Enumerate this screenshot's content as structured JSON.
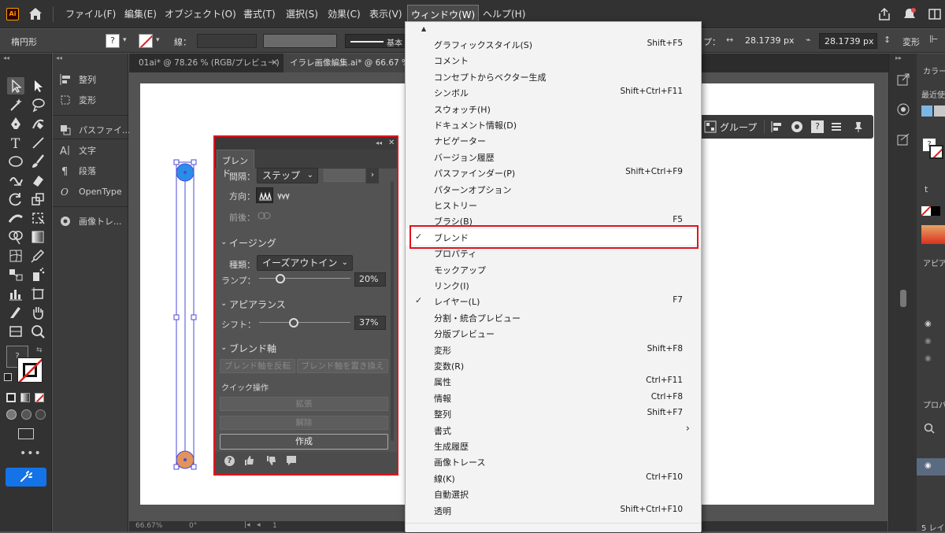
{
  "app": {
    "logo": "Ai"
  },
  "menubar": {
    "items": [
      "ファイル(F)",
      "編集(E)",
      "オブジェクト(O)",
      "書式(T)",
      "選択(S)",
      "効果(C)",
      "表示(V)",
      "ウィンドウ(W)",
      "ヘルプ(H)"
    ]
  },
  "control": {
    "shape_label": "楕円形",
    "stroke_label": "線：",
    "stroke_style": "基本",
    "width_label": "プ：",
    "w_value": "28.1739 px",
    "h_value": "28.1739 px",
    "transform_label": "変形"
  },
  "side_panels": [
    {
      "label": "整列",
      "icon": "align-icon"
    },
    {
      "label": "変形",
      "icon": "transform-icon"
    },
    {
      "label": "パスファイ...",
      "icon": "pathfinder-icon"
    },
    {
      "label": "文字",
      "icon": "character-icon"
    },
    {
      "label": "段落",
      "icon": "paragraph-icon"
    },
    {
      "label": "OpenType",
      "icon": "opentype-icon"
    },
    {
      "label": "画像トレ...",
      "icon": "image-trace-icon"
    }
  ],
  "tabs": [
    {
      "label": "01ai* @ 78.26 % (RGB/プレビュー)"
    },
    {
      "label": "イラレ画像編集.ai* @ 66.67 % (R"
    }
  ],
  "status": {
    "zoom": "66.67%",
    "rotation": "0°",
    "page": "1"
  },
  "floatbar": {
    "group_label": "グループ"
  },
  "blend_panel": {
    "title": "ブレンド",
    "spacing_label": "間隔：",
    "spacing_value": "ステップ",
    "direction_label": "方向：",
    "order_label": "前後：",
    "easing_section": "イージング",
    "type_label": "種類：",
    "type_value": "イーズアウトイン",
    "ramp_label": "ランプ：",
    "ramp_value": "20%",
    "ramp_fraction": 0.2,
    "appearance_section": "アピアランス",
    "shift_label": "シフト：",
    "shift_value": "37%",
    "shift_fraction": 0.37,
    "axis_section": "ブレンド軸",
    "reverse_btn": "ブレンド軸を反転",
    "replace_btn": "ブレンド軸を置き換え",
    "quick_label": "クイック操作",
    "expand_btn": "拡張",
    "release_btn": "解除",
    "make_btn": "作成"
  },
  "window_menu": {
    "items": [
      {
        "label": "グラフィックスタイル(S)",
        "shortcut": "Shift+F5"
      },
      {
        "label": "コメント",
        "shortcut": ""
      },
      {
        "label": "コンセプトからベクター生成",
        "shortcut": ""
      },
      {
        "label": "シンボル",
        "shortcut": "Shift+Ctrl+F11"
      },
      {
        "label": "スウォッチ(H)",
        "shortcut": ""
      },
      {
        "label": "ドキュメント情報(D)",
        "shortcut": ""
      },
      {
        "label": "ナビゲーター",
        "shortcut": ""
      },
      {
        "label": "バージョン履歴",
        "shortcut": ""
      },
      {
        "label": "パスファインダー(P)",
        "shortcut": "Shift+Ctrl+F9"
      },
      {
        "label": "パターンオプション",
        "shortcut": ""
      },
      {
        "label": "ヒストリー",
        "shortcut": ""
      },
      {
        "label": "ブラシ(B)",
        "shortcut": "F5"
      },
      {
        "label": "ブレンド",
        "shortcut": "",
        "checked": true,
        "highlighted": true
      },
      {
        "label": "プロパティ",
        "shortcut": ""
      },
      {
        "label": "モックアップ",
        "shortcut": ""
      },
      {
        "label": "リンク(I)",
        "shortcut": ""
      },
      {
        "label": "レイヤー(L)",
        "shortcut": "F7",
        "checked": true
      },
      {
        "label": "分割・統合プレビュー",
        "shortcut": ""
      },
      {
        "label": "分版プレビュー",
        "shortcut": ""
      },
      {
        "label": "変形",
        "shortcut": "Shift+F8"
      },
      {
        "label": "変数(R)",
        "shortcut": ""
      },
      {
        "label": "属性",
        "shortcut": "Ctrl+F11"
      },
      {
        "label": "情報",
        "shortcut": "Ctrl+F8"
      },
      {
        "label": "整列",
        "shortcut": "Shift+F7"
      },
      {
        "label": "書式",
        "shortcut": "",
        "submenu": true
      },
      {
        "label": "生成履歴",
        "shortcut": ""
      },
      {
        "label": "画像トレース",
        "shortcut": ""
      },
      {
        "label": "線(K)",
        "shortcut": "Ctrl+F10"
      },
      {
        "label": "自動選択",
        "shortcut": ""
      },
      {
        "label": "透明",
        "shortcut": "Shift+Ctrl+F10"
      }
    ]
  },
  "right_panel": {
    "color_label": "カラー",
    "recent_label": "最近使",
    "appearance_label": "アピア",
    "properties_label": "プロパ",
    "layers_count": "5 レイ"
  },
  "colors": {
    "accent": "#1473e6",
    "highlight_red": "#e0141c",
    "circle_top": "#2a8ee8",
    "circle_bottom": "#e3935c",
    "path_blue": "#4a4adb"
  }
}
